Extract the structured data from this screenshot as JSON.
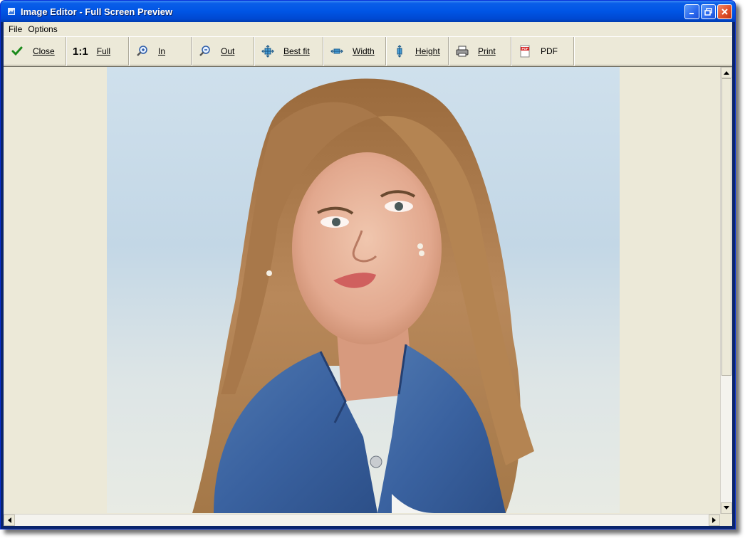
{
  "window": {
    "title": "Image Editor - Full Screen Preview",
    "icon": "image-editor-app-icon"
  },
  "menu": [
    "File",
    "Options"
  ],
  "toolbar": {
    "close": "Close",
    "ratio": "1:1",
    "full": "Full",
    "zoom_in": "In",
    "zoom_out": "Out",
    "best_fit": "Best fit",
    "width": "Width",
    "height": "Height",
    "print": "Print",
    "pdf": "PDF"
  },
  "photo": {
    "subject": "woman-portrait-denim-jacket"
  },
  "colors": {
    "titlebar": "#0055e5",
    "face": "#ece9d8",
    "check": "#1a8a1a"
  }
}
